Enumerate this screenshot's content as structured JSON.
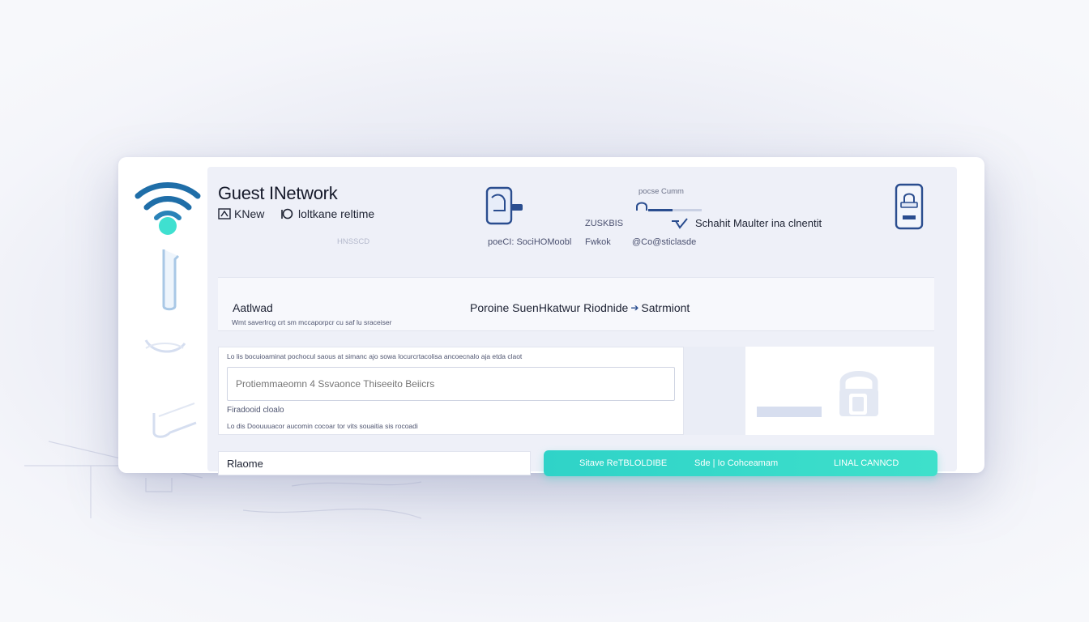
{
  "header": {
    "title": "Guest INetwork",
    "link_new": "KNew",
    "link_setting": "loltkane reltime",
    "caption_left": "HNSSCD",
    "device_caption_1": "pocse Cumm",
    "device_caption_2": "ZUSKBIS",
    "device_caption_3": "Schahit Maulter ina clnentit",
    "device_row_1": "poeCI: SociHOMoobl",
    "device_row_2": "Fwkok",
    "device_row_3": "@Co@sticlasde"
  },
  "status": {
    "label": "Aatlwad",
    "description": "Wmt saverlrcg crt sm mccaporpcr cu saf lu sraceiser",
    "message": "Poroine SuenHkatwur Riodnide",
    "message_tail": "Satrmiont"
  },
  "form": {
    "helper_top": "Lo lis bocuioaminat pochocul saous at simanc ajo sowa locurcrtacolisa ancoecnalo aja etda claot",
    "input_placeholder": "Protiemmaeomn 4 Ssvaonce Thiseeito Beiicrs",
    "label_small": "Firadooid cloalo",
    "helper_bottom": "Lo dis Doouuuacor aucomin cocoar tor vits souaitia sis rocoadi"
  },
  "bottom": {
    "field_value": "Rlaome",
    "save_label": "Sitave ReTBLOLDIBE",
    "connect_label": "Sde | Io Cohceamam",
    "cancel_label": "LINAL CANNCD"
  },
  "colors": {
    "accent_teal": "#2fd3c8",
    "wifi_blue": "#1f6ea8",
    "icon_navy": "#2a4d8f",
    "panel_bg": "#eef0f8"
  },
  "icons": [
    "wifi-icon",
    "cable-icon",
    "phone-icon",
    "lock-icon",
    "device-icon"
  ]
}
